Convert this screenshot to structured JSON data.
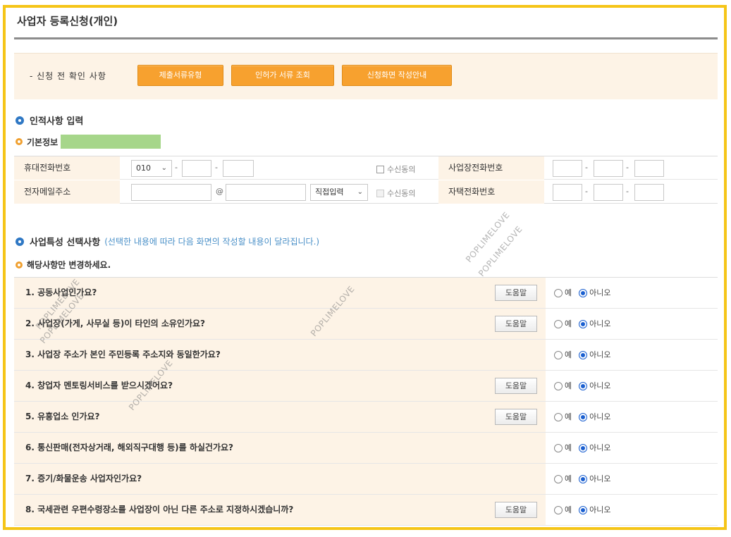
{
  "page": {
    "title": "사업자 등록신청(개인)"
  },
  "notice": {
    "label": "- 신청 전 확인 사항",
    "buttons": [
      "제출서류유형",
      "인허가 서류 조회",
      "신청화면 작성안내"
    ]
  },
  "personal": {
    "section_title": "인적사항 입력",
    "sub_title": "기본정보",
    "mobile": {
      "label": "휴대전화번호",
      "prefix": "010",
      "consent": "수신동의"
    },
    "email": {
      "label": "전자메일주소",
      "at": "@",
      "domain_select": "직접입력",
      "consent": "수신동의"
    },
    "business_phone": {
      "label": "사업장전화번호"
    },
    "home_phone": {
      "label": "자택전화번호"
    },
    "dash": "-"
  },
  "business": {
    "section_title": "사업특성 선택사항",
    "section_note": "(선택한 내용에 따라 다음 화면의 작성할 내용이 달라집니다.)",
    "sub_title": "해당사항만 변경하세요.",
    "help_label": "도움말",
    "yes_label": "예",
    "no_label": "아니오",
    "questions": [
      {
        "text": "1. 공동사업인가요?",
        "help": true,
        "answer": "no"
      },
      {
        "text": "2. 사업장(가게, 사무실 등)이 타인의 소유인가요?",
        "help": true,
        "answer": "no"
      },
      {
        "text": "3. 사업장 주소가 본인 주민등록 주소지와 동일한가요?",
        "help": false,
        "answer": "no"
      },
      {
        "text": "4. 창업자 멘토링서비스를 받으시겠어요?",
        "help": true,
        "answer": "no"
      },
      {
        "text": "5. 유흥업소 인가요?",
        "help": true,
        "answer": "no"
      },
      {
        "text": "6. 통신판매(전자상거래, 해외직구대행 등)를 하실건가요?",
        "help": false,
        "answer": "no"
      },
      {
        "text": "7. 증기/화물운송 사업자인가요?",
        "help": false,
        "answer": "no"
      },
      {
        "text": "8. 국세관련 우편수령장소를 사업장이 아닌 다른 주소로 지정하시겠습니까?",
        "help": true,
        "answer": "no"
      }
    ]
  },
  "watermark": "POPLIMELOVE",
  "colors": {
    "frame": "#f5c518",
    "button": "#f7a12f",
    "label_bg": "#fdf3e6",
    "radio_selected": "#1a5fd0",
    "highlight": "#a6d68a"
  }
}
